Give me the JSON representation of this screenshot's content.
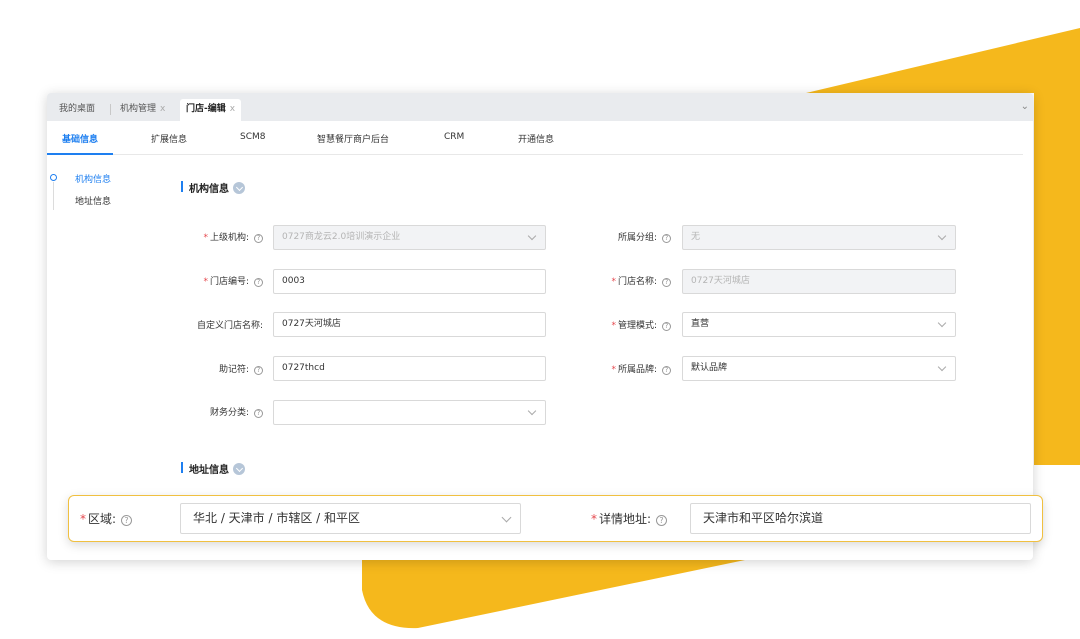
{
  "colors": {
    "accent": "#1e7ff0",
    "required": "#e5484d",
    "decor_yellow": "#f5b81c",
    "highlight_border": "#f0c040"
  },
  "top_tabs": [
    {
      "label": "我的桌面"
    },
    {
      "label": "机构管理",
      "close": "x"
    },
    {
      "label": "门店-编辑",
      "close": "x"
    }
  ],
  "sub_tabs": [
    "基础信息",
    "扩展信息",
    "SCM8",
    "智慧餐厅商户后台",
    "CRM",
    "开通信息"
  ],
  "side_nav": [
    "机构信息",
    "地址信息"
  ],
  "sections": {
    "org_info": "机构信息",
    "address_info": "地址信息"
  },
  "form": {
    "parent_org": {
      "label": "上级机构:",
      "value": "0727商龙云2.0培训演示企业"
    },
    "group": {
      "label": "所属分组:",
      "value": "无"
    },
    "store_code": {
      "label": "门店编号:",
      "value": "0003"
    },
    "store_name": {
      "label": "门店名称:",
      "value": "0727天河城店"
    },
    "custom_name": {
      "label": "自定义门店名称:",
      "value": "0727天河城店"
    },
    "mgmt_mode": {
      "label": "管理模式:",
      "value": "直营"
    },
    "mnemonic": {
      "label": "助记符:",
      "value": "0727thcd"
    },
    "brand": {
      "label": "所属品牌:",
      "value": "默认品牌"
    },
    "finance_class": {
      "label": "财务分类:",
      "value": ""
    }
  },
  "highlight": {
    "region": {
      "label": "区域:",
      "value": "华北 / 天津市 / 市辖区 / 和平区"
    },
    "address": {
      "label": "详情地址:",
      "value": "天津市和平区哈尔滨道"
    }
  },
  "icons": {
    "help": "?",
    "required_mark": "*"
  }
}
